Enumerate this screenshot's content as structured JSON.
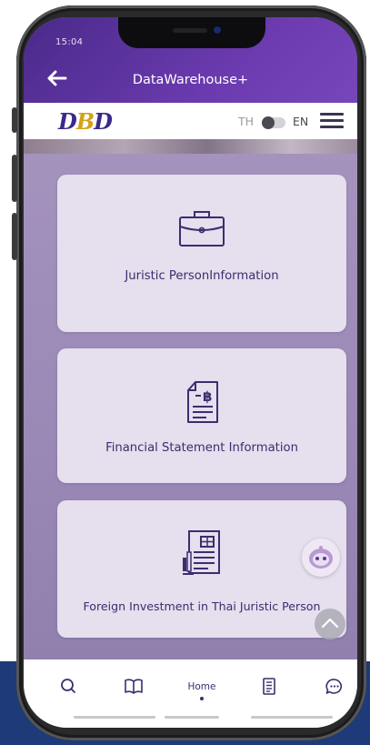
{
  "status_bar": {
    "time": "15:04"
  },
  "header": {
    "title": "DataWarehouse+"
  },
  "logo": {
    "part1": "D",
    "part2": "B",
    "part3": "D"
  },
  "language": {
    "th": "TH",
    "en": "EN",
    "selected": "EN"
  },
  "cards": [
    {
      "label": "Juristic PersonInformation",
      "icon": "briefcase-icon"
    },
    {
      "label": "Financial Statement Information",
      "icon": "baht-document-icon"
    },
    {
      "label": "Foreign Investment in Thai Juristic Person",
      "icon": "report-chart-icon"
    }
  ],
  "bottom_nav": {
    "items": [
      {
        "name": "search",
        "icon": "search-icon"
      },
      {
        "name": "book",
        "icon": "book-icon"
      },
      {
        "name": "home",
        "label": "Home",
        "active": true
      },
      {
        "name": "document",
        "icon": "document-icon"
      },
      {
        "name": "chat",
        "icon": "chat-icon"
      }
    ]
  },
  "colors": {
    "header": "#5a2e9e",
    "card_bg": "#e5dfee",
    "text_accent": "#3e2c6e",
    "logo_primary": "#3a2a8a",
    "logo_accent": "#d4a21a",
    "page_bottom": "#1e3a78"
  }
}
